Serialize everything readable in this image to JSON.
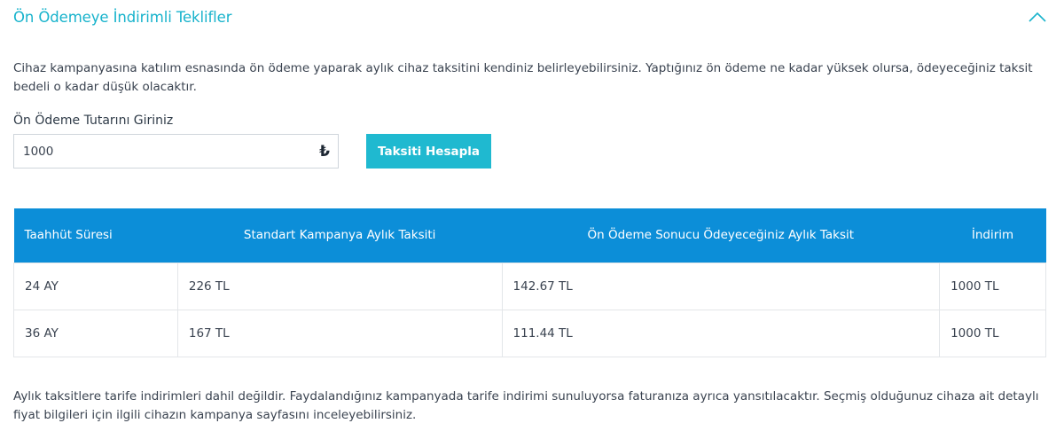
{
  "section": {
    "title": "Ön Ödemeye İndirimli Teklifler",
    "collapse_icon": "chevron-up-icon"
  },
  "description": "Cihaz kampanyasına katılım esnasında ön ödeme yaparak aylık cihaz taksitini kendiniz belirleyebilirsiniz. Yaptığınız ön ödeme ne kadar yüksek olursa, ödeyeceğiniz taksit bedeli o kadar düşük olacaktır.",
  "form": {
    "label": "Ön Ödeme Tutarını Giriniz",
    "amount_value": "1000",
    "currency_symbol": "₺",
    "calculate_label": "Taksiti Hesapla"
  },
  "table": {
    "headers": [
      "Taahhüt Süresi",
      "Standart Kampanya Aylık Taksiti",
      "Ön Ödeme Sonucu Ödeyeceğiniz Aylık Taksit",
      "İndirim"
    ],
    "rows": [
      [
        "24 AY",
        "226 TL",
        "142.67 TL",
        "1000 TL"
      ],
      [
        "36 AY",
        "167 TL",
        "111.44 TL",
        "1000 TL"
      ]
    ]
  },
  "note": "Aylık taksitlere tarife indirimleri dahil değildir. Faydalandığınız kampanyada tarife indirimi sunuluyorsa faturanıza ayrıca yansıtılacaktır. Seçmiş olduğunuz cihaza ait detaylı fiyat bilgileri için ilgili cihazın kampanya sayfasını inceleyebilirsiniz.",
  "colors": {
    "accent": "#18b3cc",
    "button": "#1fb9d0",
    "table_header": "#0c8ed8"
  }
}
